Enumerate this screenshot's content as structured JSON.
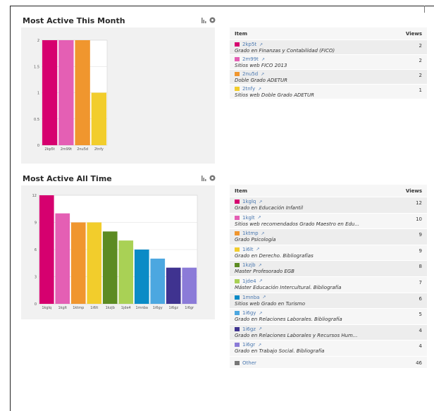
{
  "month": {
    "title": "Most Active This Month",
    "table": {
      "col_item": "Item",
      "col_views": "Views",
      "rows": [
        {
          "code": "2kp5t",
          "desc": "Grado en Finanzas y Contabilidad (FICO)",
          "views": "2",
          "color": "#d6006f"
        },
        {
          "code": "2m99t",
          "desc": "Sitios web FICO 2013",
          "views": "2",
          "color": "#e45fb4"
        },
        {
          "code": "2nu5d",
          "desc": "Doble Grado ADETUR",
          "views": "2",
          "color": "#f0962e"
        },
        {
          "code": "2tnfy",
          "desc": "Sitios web Doble Grado ADETUR",
          "views": "1",
          "color": "#f2cd2c"
        }
      ]
    }
  },
  "alltime": {
    "title": "Most Active All Time",
    "table": {
      "col_item": "Item",
      "col_views": "Views",
      "rows": [
        {
          "code": "1kglq",
          "desc": "Grado en Educación Infantil",
          "views": "12",
          "color": "#d6006f"
        },
        {
          "code": "1kglt",
          "desc": "Sitios web recomendados Grado Maestro en Edu...",
          "views": "10",
          "color": "#e45fb4"
        },
        {
          "code": "1ktmp",
          "desc": "Grado Psicología",
          "views": "9",
          "color": "#f0962e"
        },
        {
          "code": "1i6lt",
          "desc": "Grado en Derecho. Bibliografías",
          "views": "9",
          "color": "#f2cd2c"
        },
        {
          "code": "1kzjb",
          "desc": "Master Profesorado EGB",
          "views": "8",
          "color": "#5c8b22"
        },
        {
          "code": "1jde4",
          "desc": "Máster Educación Intercultural. Bibliografía",
          "views": "7",
          "color": "#a9d155"
        },
        {
          "code": "1mnba",
          "desc": "Sitios web Grado en Turismo",
          "views": "6",
          "color": "#0a8bc6"
        },
        {
          "code": "1i6gy",
          "desc": "Grado en Relaciones Laborales. Bibliografía",
          "views": "5",
          "color": "#4ca7e0"
        },
        {
          "code": "1i6gz",
          "desc": "Grado en Relaciones Laborales y Recursos Hum...",
          "views": "4",
          "color": "#3f3390"
        },
        {
          "code": "1i6gr",
          "desc": "Grado en Trabajo Social. Bibliografía",
          "views": "4",
          "color": "#8b7bd8"
        }
      ],
      "other": {
        "label": "Other",
        "views": "46",
        "color": "#777777"
      }
    }
  },
  "icons": {
    "chart": "bar-chart-icon",
    "settings": "gear-icon",
    "external": "external-link-icon"
  },
  "chart_data": [
    {
      "type": "bar",
      "categories": [
        "2kp5t",
        "2m99t",
        "2nu5d",
        "2tnfy"
      ],
      "values": [
        2,
        2,
        2,
        1
      ],
      "colors": [
        "#d6006f",
        "#e45fb4",
        "#f0962e",
        "#f2cd2c"
      ],
      "yticks": [
        0,
        0.5,
        1,
        1.5,
        2
      ],
      "ylim": [
        0,
        2
      ],
      "grid": true
    },
    {
      "type": "bar",
      "categories": [
        "1kglq",
        "1kglt",
        "1ktmp",
        "1i6lt",
        "1kzjb",
        "1jde4",
        "1mnba",
        "1i6gy",
        "1i6gz",
        "1i6gr"
      ],
      "values": [
        12,
        10,
        9,
        9,
        8,
        7,
        6,
        5,
        4,
        4
      ],
      "colors": [
        "#d6006f",
        "#e45fb4",
        "#f0962e",
        "#f2cd2c",
        "#5c8b22",
        "#a9d155",
        "#0a8bc6",
        "#4ca7e0",
        "#3f3390",
        "#8b7bd8"
      ],
      "yticks": [
        0,
        3,
        6,
        9,
        12
      ],
      "ylim": [
        0,
        12
      ],
      "grid": true
    }
  ]
}
